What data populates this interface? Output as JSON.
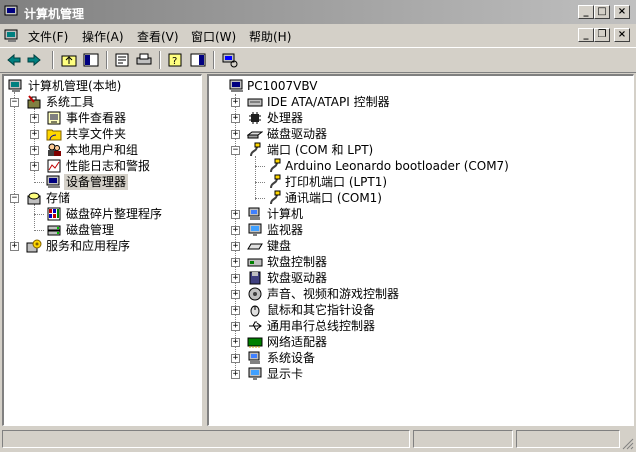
{
  "window": {
    "title": "计算机管理"
  },
  "menubar": {
    "items": [
      "文件(F)",
      "操作(A)",
      "查看(V)",
      "窗口(W)",
      "帮助(H)"
    ]
  },
  "toolbar": {
    "buttons": [
      "back-icon",
      "forward-icon",
      "up-icon",
      "show-hide-tree-icon",
      "properties-icon",
      "print-icon",
      "help-icon",
      "action-pane-icon",
      "computer-icon"
    ]
  },
  "left_tree": {
    "root": "计算机管理(本地)",
    "system_tools": "系统工具",
    "event_viewer": "事件查看器",
    "shared_folders": "共享文件夹",
    "local_users": "本地用户和组",
    "perf_logs": "性能日志和警报",
    "device_manager": "设备管理器",
    "storage": "存储",
    "defrag": "磁盘碎片整理程序",
    "disk_mgmt": "磁盘管理",
    "services": "服务和应用程序"
  },
  "right_tree": {
    "computer": "PC1007VBV",
    "items": [
      "IDE ATA/ATAPI 控制器",
      "处理器",
      "磁盘驱动器",
      "端口 (COM 和 LPT)",
      "Arduino Leonardo bootloader (COM7)",
      "打印机端口 (LPT1)",
      "通讯端口 (COM1)",
      "计算机",
      "监视器",
      "键盘",
      "软盘控制器",
      "软盘驱动器",
      "声音、视频和游戏控制器",
      "鼠标和其它指针设备",
      "通用串行总线控制器",
      "网络适配器",
      "系统设备",
      "显示卡"
    ]
  }
}
